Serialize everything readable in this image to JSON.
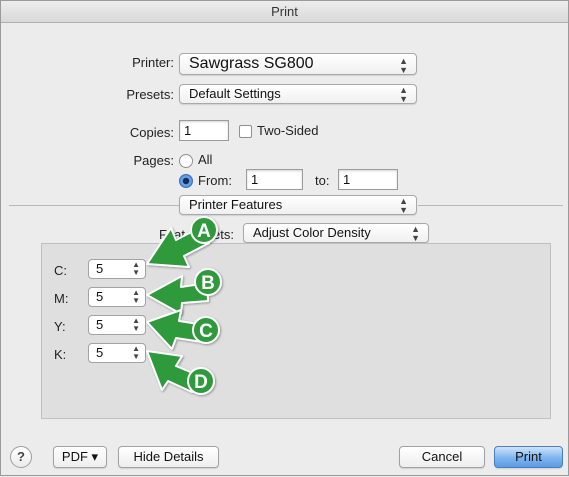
{
  "window": {
    "title": "Print"
  },
  "printer": {
    "label": "Printer:",
    "value": "Sawgrass SG800"
  },
  "presets": {
    "label": "Presets:",
    "value": "Default Settings"
  },
  "copies": {
    "label": "Copies:",
    "value": "1",
    "two_sided_label": "Two-Sided",
    "two_sided_checked": false
  },
  "pages": {
    "label": "Pages:",
    "all_label": "All",
    "from_label": "From:",
    "from_value": "1",
    "to_label": "to:",
    "to_value": "1",
    "selected": "From"
  },
  "section": {
    "value": "Printer Features"
  },
  "feature_sets": {
    "label_visible_start": "Feat",
    "label_visible_end": "ets:",
    "value": "Adjust Color Density"
  },
  "channels": [
    {
      "label": "C:",
      "value": "5"
    },
    {
      "label": "M:",
      "value": "5"
    },
    {
      "label": "Y:",
      "value": "5"
    },
    {
      "label": "K:",
      "value": "5"
    }
  ],
  "callouts": [
    "A",
    "B",
    "C",
    "D"
  ],
  "callout_color": "#2e9a3a",
  "footer": {
    "help_label": "?",
    "pdf_label": "PDF ▾",
    "hide_details_label": "Hide Details",
    "cancel_label": "Cancel",
    "print_label": "Print"
  },
  "icons": {
    "popup_arrows": "up-down-arrows-icon",
    "stepper_arrows": "stepper-arrows-icon",
    "callout": "green-arrow-callout-icon"
  }
}
